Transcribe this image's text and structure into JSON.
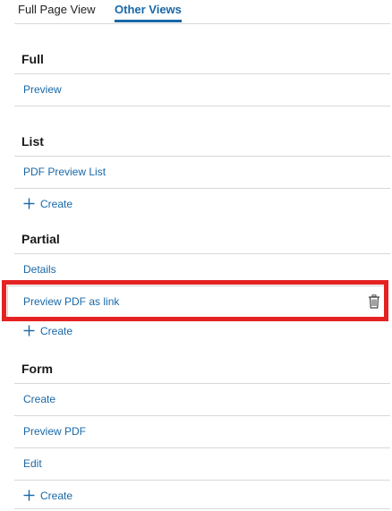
{
  "tabs": {
    "full_page_view": "Full Page View",
    "other_views": "Other Views"
  },
  "sections": {
    "full": {
      "title": "Full",
      "items": [
        "Preview"
      ]
    },
    "list": {
      "title": "List",
      "items": [
        "PDF Preview List"
      ],
      "create_label": "Create"
    },
    "partial": {
      "title": "Partial",
      "items": [
        "Details",
        "Preview PDF as link"
      ],
      "create_label": "Create"
    },
    "form": {
      "title": "Form",
      "items": [
        "Create",
        "Preview PDF",
        "Edit"
      ],
      "create_label": "Create"
    }
  },
  "icons": {
    "plus": "plus-icon",
    "trash": "trash-icon"
  },
  "colors": {
    "link": "#1868a8",
    "highlight": "#e52222",
    "divider": "#d8d8d8"
  }
}
